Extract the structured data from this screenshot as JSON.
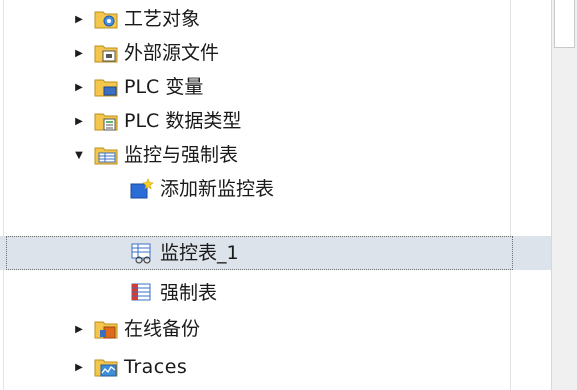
{
  "tree": {
    "items": [
      {
        "label": "工艺对象",
        "icon": "technology-objects-folder-icon",
        "state": "collapsed"
      },
      {
        "label": "外部源文件",
        "icon": "external-source-folder-icon",
        "state": "collapsed"
      },
      {
        "label": "PLC 变量",
        "icon": "plc-tags-folder-icon",
        "state": "collapsed"
      },
      {
        "label": "PLC 数据类型",
        "icon": "plc-data-types-folder-icon",
        "state": "collapsed"
      },
      {
        "label": "监控与强制表",
        "icon": "watch-force-tables-folder-icon",
        "state": "expanded"
      },
      {
        "label": "添加新监控表",
        "icon": "add-new-watch-table-icon",
        "state": "leaf"
      },
      {
        "label": "监控表_1",
        "icon": "watch-table-icon",
        "state": "leaf",
        "selected": true
      },
      {
        "label": "强制表",
        "icon": "force-table-icon",
        "state": "leaf"
      },
      {
        "label": "在线备份",
        "icon": "online-backups-folder-icon",
        "state": "collapsed"
      },
      {
        "label": "Traces",
        "icon": "traces-folder-icon",
        "state": "collapsed"
      }
    ]
  },
  "colors": {
    "selection": "#dde3ea",
    "folder": "#f4c64d",
    "accent_blue": "#2b6cd6"
  }
}
